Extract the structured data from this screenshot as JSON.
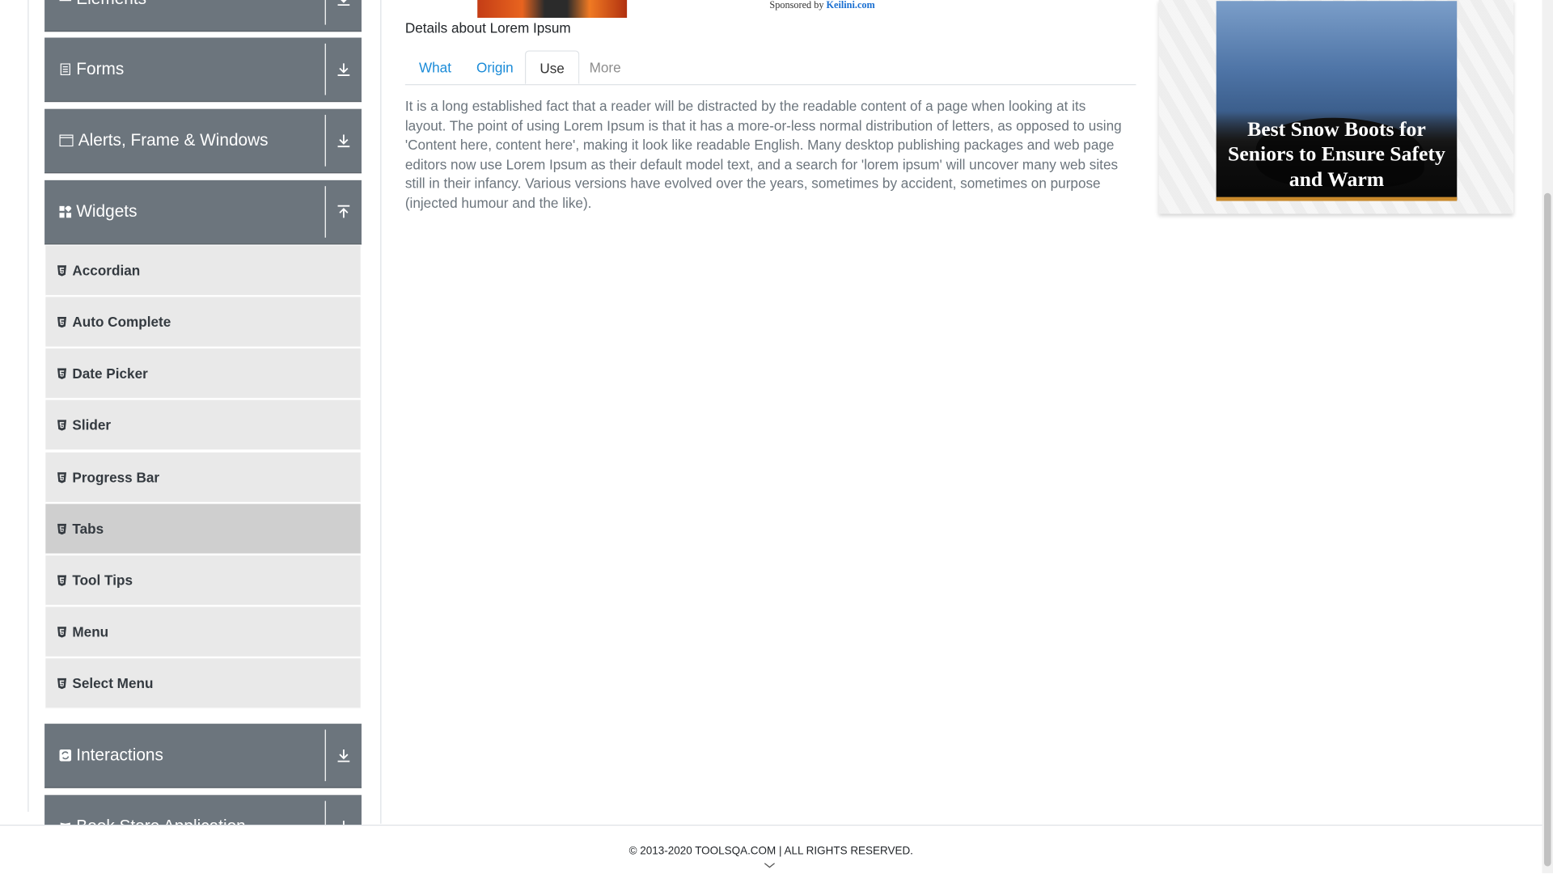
{
  "sidebar": {
    "groups": [
      {
        "label": "Elements",
        "toggle": "expand"
      },
      {
        "label": "Forms",
        "toggle": "expand"
      },
      {
        "label": "Alerts, Frame & Windows",
        "toggle": "expand"
      },
      {
        "label": "Widgets",
        "toggle": "collapse"
      },
      {
        "label": "Interactions",
        "toggle": "expand"
      },
      {
        "label": "Book Store Application",
        "toggle": "expand"
      }
    ],
    "widget_items": [
      "Accordian",
      "Auto Complete",
      "Date Picker",
      "Slider",
      "Progress Bar",
      "Tabs",
      "Tool Tips",
      "Menu",
      "Select Menu"
    ],
    "active_item": "Tabs"
  },
  "main": {
    "sponsored_prefix": "Sponsored by",
    "sponsored_link": "Keilini.com",
    "details_heading": "Details about Lorem Ipsum",
    "tabs": [
      {
        "label": "What",
        "state": "link"
      },
      {
        "label": "Origin",
        "state": "link"
      },
      {
        "label": "Use",
        "state": "active"
      },
      {
        "label": "More",
        "state": "disabled"
      }
    ],
    "tab_content": "It is a long established fact that a reader will be distracted by the readable content of a page when looking at its layout. The point of using Lorem Ipsum is that it has a more-or-less normal distribution of letters, as opposed to using 'Content here, content here', making it look like readable English. Many desktop publishing packages and web page editors now use Lorem Ipsum as their default model text, and a search for 'lorem ipsum' will uncover many web sites still in their infancy. Various versions have evolved over the years, sometimes by accident, sometimes on purpose (injected humour and the like)."
  },
  "ad": {
    "caption": "Best Snow Boots for Seniors to Ensure Safety and Warm"
  },
  "footer": {
    "text": "© 2013-2020 TOOLSQA.COM | ALL RIGHTS RESERVED."
  },
  "colors": {
    "sidebar_header": "#6c757d",
    "sidebar_item": "#e9e9e9",
    "sidebar_item_active": "#cfcfcf",
    "tab_link": "#1a8bd8",
    "ad_link": "#1a6fd1"
  }
}
